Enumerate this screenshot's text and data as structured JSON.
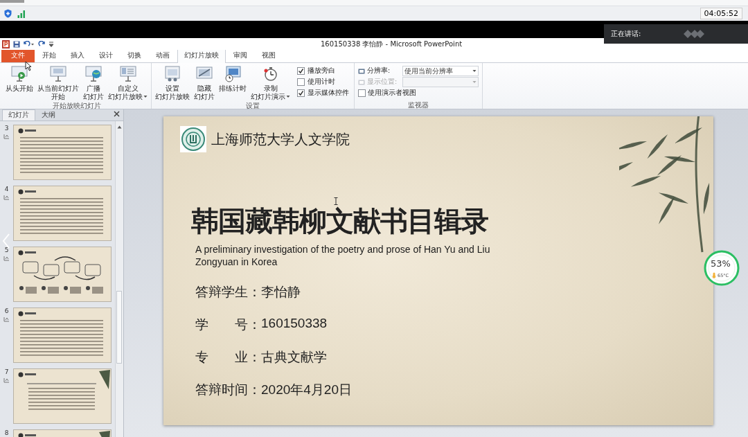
{
  "status_bar": {
    "time": "04:05:52"
  },
  "speaking_popup": {
    "label": "正在讲话:"
  },
  "window": {
    "title": "160150338 李怡静 - Microsoft PowerPoint"
  },
  "tabs": [
    {
      "label": "文件",
      "kind": "file",
      "selected": false
    },
    {
      "label": "开始",
      "kind": "tab",
      "selected": false
    },
    {
      "label": "插入",
      "kind": "tab",
      "selected": false
    },
    {
      "label": "设计",
      "kind": "tab",
      "selected": false
    },
    {
      "label": "切换",
      "kind": "tab",
      "selected": false
    },
    {
      "label": "动画",
      "kind": "tab",
      "selected": false
    },
    {
      "label": "幻灯片放映",
      "kind": "tab",
      "selected": true
    },
    {
      "label": "审阅",
      "kind": "tab",
      "selected": false
    },
    {
      "label": "视图",
      "kind": "tab",
      "selected": false
    }
  ],
  "ribbon": {
    "groups": [
      {
        "label": "开始放映幻灯片",
        "items": [
          {
            "kind": "large",
            "lines": [
              "从头开始"
            ],
            "menu": false
          },
          {
            "kind": "large",
            "lines": [
              "从当前幻灯片",
              "开始"
            ],
            "menu": false
          },
          {
            "kind": "large",
            "lines": [
              "广播",
              "幻灯片"
            ],
            "menu": false
          },
          {
            "kind": "large",
            "lines": [
              "自定义",
              "幻灯片放映"
            ],
            "menu": true
          }
        ]
      },
      {
        "label": "设置",
        "items": [
          {
            "kind": "large",
            "lines": [
              "设置",
              "幻灯片放映"
            ],
            "menu": false
          },
          {
            "kind": "large",
            "lines": [
              "隐藏",
              "幻灯片"
            ],
            "menu": false
          },
          {
            "kind": "large",
            "lines": [
              "排练计时"
            ],
            "menu": false
          },
          {
            "kind": "large",
            "lines": [
              "录制",
              "幻灯片演示"
            ],
            "menu": true
          },
          {
            "kind": "checks",
            "options": [
              {
                "label": "播放旁白",
                "checked": true
              },
              {
                "label": "使用计时",
                "checked": false
              },
              {
                "label": "显示媒体控件",
                "checked": true
              }
            ]
          }
        ]
      },
      {
        "label": "监视器",
        "items": [
          {
            "kind": "fields",
            "rows": [
              {
                "kind": "dropdown",
                "label": "分辨率:",
                "value": "使用当前分辨率",
                "disabled": false
              },
              {
                "kind": "dropdown",
                "label": "显示位置:",
                "disabled": true
              },
              {
                "kind": "check",
                "label": "使用演示者视图",
                "checked": false
              }
            ]
          }
        ]
      }
    ]
  },
  "sidebar": {
    "tabs": [
      {
        "label": "幻灯片",
        "selected": true
      },
      {
        "label": "大纲",
        "selected": false
      }
    ],
    "slides": [
      {
        "number": "3",
        "kind": "text"
      },
      {
        "number": "4",
        "kind": "text"
      },
      {
        "number": "5",
        "kind": "diagram"
      },
      {
        "number": "6",
        "kind": "text"
      },
      {
        "number": "7",
        "kind": "bamboo"
      },
      {
        "number": "8",
        "kind": "bamboo"
      }
    ]
  },
  "slide": {
    "school": "上海师范大学人文学院",
    "title": "韩国藏韩柳文献书目辑录",
    "subtitle": "A preliminary investigation of the poetry and prose of Han Yu and Liu Zongyuan in Korea",
    "fields": [
      {
        "label": "答辩学生：",
        "value": "李怡静"
      },
      {
        "label": "学　　号：",
        "value": "160150338"
      },
      {
        "label": "专　　业：",
        "value": "古典文献学"
      },
      {
        "label": "答辩时间：",
        "value": "2020年4月20日"
      }
    ]
  },
  "meter": {
    "value": "53%",
    "temperature": "65°C"
  }
}
